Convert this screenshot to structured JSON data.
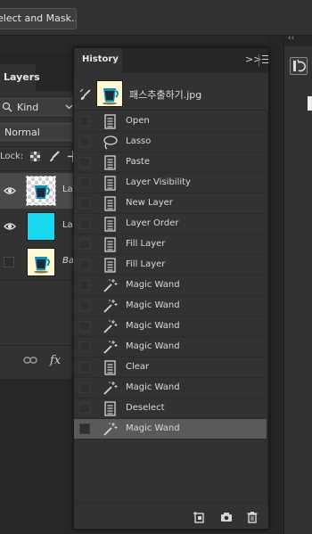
{
  "options_bar": {
    "select_mask_label": "elect and Mask..."
  },
  "layers_panel": {
    "tab_label": "Layers",
    "filter_kind": "Kind",
    "blend_mode": "Normal",
    "lock_label": "Lock:",
    "layers": [
      {
        "name": "Lay",
        "visible": true,
        "selected": true,
        "thumb": "transparent-cup"
      },
      {
        "name": "Lay",
        "visible": true,
        "selected": false,
        "thumb": "cyan-fill"
      },
      {
        "name": "Ba",
        "visible": false,
        "selected": false,
        "thumb": "cup-image",
        "italic": true
      }
    ]
  },
  "history_panel": {
    "tab_label": "History",
    "collapse_glyph": ">>",
    "snapshot": {
      "name": "패스추출하기.jpg"
    },
    "states": [
      {
        "label": "Open",
        "icon": "document-icon"
      },
      {
        "label": "Lasso",
        "icon": "lasso-icon"
      },
      {
        "label": "Paste",
        "icon": "document-icon"
      },
      {
        "label": "Layer Visibility",
        "icon": "document-icon"
      },
      {
        "label": "New Layer",
        "icon": "document-icon"
      },
      {
        "label": "Layer Order",
        "icon": "document-icon"
      },
      {
        "label": "Fill Layer",
        "icon": "document-icon"
      },
      {
        "label": "Fill Layer",
        "icon": "document-icon"
      },
      {
        "label": "Magic Wand",
        "icon": "magic-wand-icon"
      },
      {
        "label": "Magic Wand",
        "icon": "magic-wand-icon"
      },
      {
        "label": "Magic Wand",
        "icon": "magic-wand-icon"
      },
      {
        "label": "Magic Wand",
        "icon": "magic-wand-icon"
      },
      {
        "label": "Clear",
        "icon": "document-icon"
      },
      {
        "label": "Magic Wand",
        "icon": "magic-wand-icon"
      },
      {
        "label": "Deselect",
        "icon": "document-icon"
      },
      {
        "label": "Magic Wand",
        "icon": "magic-wand-icon",
        "active": true
      }
    ],
    "footer_icons": [
      "new-document-from-state-icon",
      "camera-icon",
      "trash-icon"
    ]
  },
  "colors": {
    "panel_bg": "#323232",
    "active_row": "#5a5a5a",
    "cyan_layer": "#18d8f0"
  }
}
